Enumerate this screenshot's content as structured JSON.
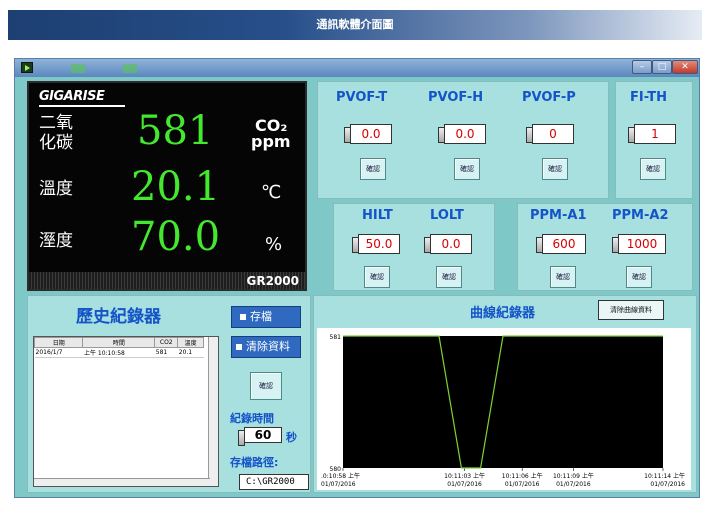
{
  "caption": "通訊軟體介面圖",
  "display": {
    "brand": "GIGARISE",
    "rows": [
      {
        "label_line1": "二氧",
        "label_line2": "化碳",
        "value": "581",
        "unit_line1": "CO₂",
        "unit_line2": "ppm"
      },
      {
        "label": "溫度",
        "value": "20.1",
        "unit": "℃"
      },
      {
        "label": "溼度",
        "value": "70.0",
        "unit": "%"
      }
    ],
    "model": "GR2000"
  },
  "params": [
    {
      "title": "PVOF-T",
      "value": "0.0",
      "confirm": "確認"
    },
    {
      "title": "PVOF-H",
      "value": "0.0",
      "confirm": "確認"
    },
    {
      "title": "PVOF-P",
      "value": "0",
      "confirm": "確認"
    },
    {
      "title": "FI-TH",
      "value": "1",
      "confirm": "確認"
    },
    {
      "title": "HILT",
      "value": "50.0",
      "confirm": "確認"
    },
    {
      "title": "LOLT",
      "value": "0.0",
      "confirm": "確認"
    },
    {
      "title": "PPM-A1",
      "value": "600",
      "confirm": "確認"
    },
    {
      "title": "PPM-A2",
      "value": "1000",
      "confirm": "確認"
    }
  ],
  "history": {
    "title": "歷史紀錄器",
    "save_label": "存檔",
    "clear_label": "清除資料",
    "confirm": "確認",
    "interval_label": "紀錄時間",
    "interval_value": "60",
    "interval_unit": "秒",
    "path_label": "存檔路徑:",
    "path_value": "C:\\GR2000",
    "columns": [
      "日期",
      "時間",
      "CO2",
      "溫度"
    ],
    "rows": [
      [
        "2016/1/7",
        "上午 10:10:58",
        "581",
        "20.1"
      ]
    ]
  },
  "curve": {
    "title": "曲線紀錄器",
    "clear_label": "清除曲線資料",
    "chart_data": {
      "type": "line",
      "ylim": [
        580,
        581
      ],
      "y_ticks": [
        "581",
        "580"
      ],
      "x_ticks": [
        {
          "time": ".0:10:58 上午",
          "date": "01/07/2016"
        },
        {
          "time": "10:11:03 上午",
          "date": "01/07/2016"
        },
        {
          "time": "10:11:06 上午",
          "date": "01/07/2016"
        },
        {
          "time": "10:11:09 上午",
          "date": "01/07/2016"
        },
        {
          "time": "10:11:14 上午",
          "date": "01/07/2016"
        }
      ],
      "series": [
        {
          "color": "#7fd235",
          "x": [
            0,
            0.3,
            0.37,
            0.43,
            0.5,
            1
          ],
          "y": [
            581,
            581,
            580,
            580,
            581,
            581
          ]
        }
      ],
      "background": "#000000"
    }
  }
}
